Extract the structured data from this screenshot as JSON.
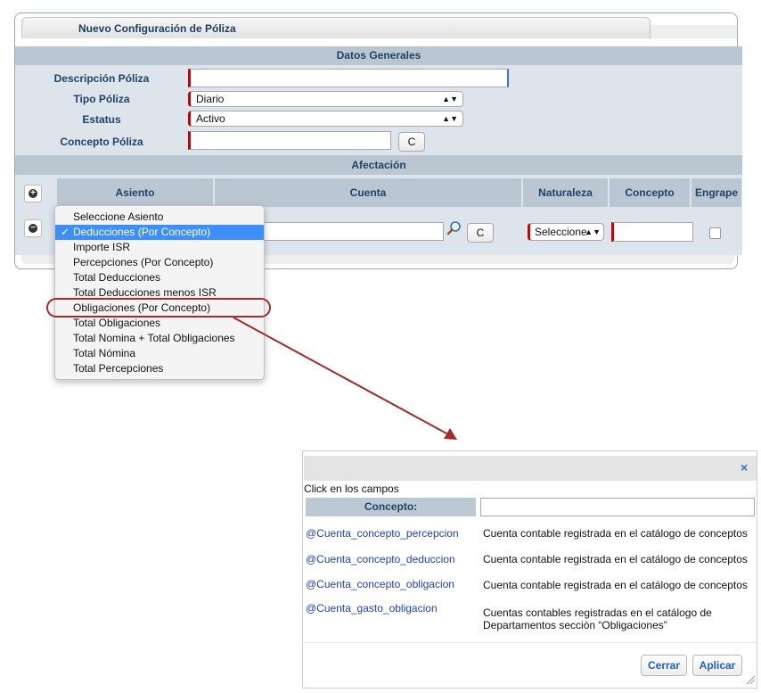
{
  "panel": {
    "title": "Nuevo Configuración de Póliza"
  },
  "datos_generales": {
    "header": "Datos Generales",
    "descripcion_label": "Descripción Póliza",
    "descripcion_value": "",
    "tipo_label": "Tipo Póliza",
    "tipo_value": "Diario",
    "estatus_label": "Estatus",
    "estatus_value": "Activo",
    "concepto_label": "Concepto Póliza",
    "concepto_value": "",
    "c_button": "C"
  },
  "afectacion": {
    "header": "Afectación",
    "columns": {
      "asiento": "Asiento",
      "cuenta": "Cuenta",
      "naturaleza": "Naturaleza",
      "concepto": "Concepto",
      "engrape": "Engrape"
    },
    "row": {
      "naturaleza_value": "Seleccione",
      "c_button": "C"
    }
  },
  "asiento_menu": {
    "items": [
      "Seleccione Asiento",
      "Deducciones (Por Concepto)",
      "Importe ISR",
      "Percepciones (Por Concepto)",
      "Total Deducciones",
      "Total Deducciones menos ISR",
      "Obligaciones (Por Concepto)",
      "Total Obligaciones",
      "Total Nomina + Total Obligaciones",
      "Total Nómina",
      "Total Percepciones"
    ],
    "selected_index": 1,
    "check_mark": "✓"
  },
  "dialog": {
    "close": "×",
    "help_text": "Click en los campos",
    "concepto_label": "Concepto:",
    "concepto_value": "",
    "rows": [
      {
        "var": "@Cuenta_concepto_percepcion",
        "desc": "Cuenta contable registrada en el catálogo de conceptos"
      },
      {
        "var": "@Cuenta_concepto_deduccion",
        "desc": "Cuenta contable registrada en el catálogo de conceptos"
      },
      {
        "var": "@Cuenta_concepto_obligacion",
        "desc": "Cuenta contable registrada en el catálogo de conceptos"
      },
      {
        "var": "@Cuenta_gasto_obligacion",
        "desc": "Cuentas contables registradas en el catálogo de Departamentos sección “Obligaciones”"
      }
    ],
    "cerrar": "Cerrar",
    "aplicar": "Aplicar"
  },
  "colors": {
    "header_bg": "#bac7d3",
    "header_text": "#1f4266",
    "form_bg": "#dde4ec",
    "accent_red": "#a32b2b",
    "link_blue": "#1e3fbf"
  }
}
